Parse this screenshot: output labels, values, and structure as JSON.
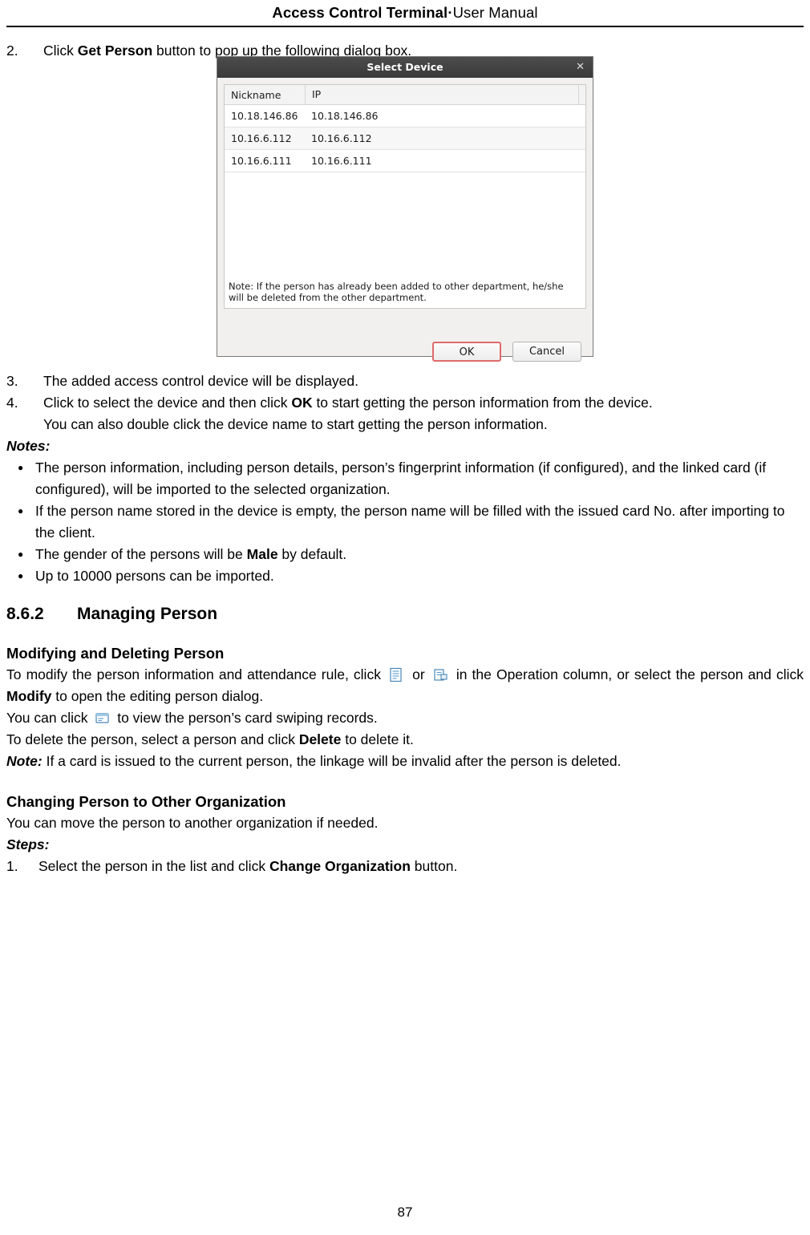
{
  "header": {
    "title_bold": "Access Control Terminal",
    "title_sep": "·",
    "title_normal": "User Manual"
  },
  "steps": {
    "step2_num": "2.",
    "step2_a": "Click ",
    "step2_bold": "Get Person",
    "step2_b": " button to pop up the following dialog box.",
    "step3_num": "3.",
    "step3_text": "The added access control device will be displayed.",
    "step4_num": "4.",
    "step4_a": "Click to select the device and then click ",
    "step4_bold": "OK",
    "step4_b": " to start getting the person information from the device.",
    "step4_c": "You can also double click the device name to start getting the person information."
  },
  "dialog": {
    "title": "Select Device",
    "close": "✕",
    "columns": [
      "Nickname",
      "IP"
    ],
    "rows": [
      {
        "nickname": "10.18.146.86",
        "ip": "10.18.146.86"
      },
      {
        "nickname": "10.16.6.112",
        "ip": "10.16.6.112"
      },
      {
        "nickname": "10.16.6.111",
        "ip": "10.16.6.111"
      }
    ],
    "note": "Note: If the person has already been added to other department, he/she will be deleted from the other department.",
    "ok_label": "OK",
    "cancel_label": "Cancel"
  },
  "notes": {
    "label": "Notes:",
    "items": [
      "The person information, including person details, person’s fingerprint information (if configured), and the linked card (if configured), will be imported to the selected organization.",
      "If the person name stored in the device is empty, the person name will be filled with the issued card No. after importing to the client.",
      "The gender of the persons will be Male by default.",
      "Up to 10000 persons can be imported."
    ],
    "item3_a": "The gender of the persons will be ",
    "item3_bold": "Male",
    "item3_b": " by default."
  },
  "section": {
    "number": "8.6.2",
    "title": "Managing Person"
  },
  "modify": {
    "heading": "Modifying and Deleting Person",
    "p1_a": "To modify the person information and attendance rule, click ",
    "p1_or": " or ",
    "p1_b": " in the Operation column, or select the person and click ",
    "p1_bold": "Modify",
    "p1_c": " to open the editing person dialog.",
    "p2_a": "You can click ",
    "p2_b": " to view the person’s card swiping records.",
    "p3_a": "To delete the person, select a person and click ",
    "p3_bold": "Delete",
    "p3_b": " to delete it.",
    "note_label": "Note:",
    "note_text": " If a card is issued to the current person, the linkage will be invalid after the person is deleted."
  },
  "changing": {
    "heading": "Changing Person to Other Organization",
    "p1": "You can move the person to another organization if needed.",
    "steps_label": "Steps:",
    "step1_num": "1.",
    "step1_a": "Select the person in the list and click ",
    "step1_bold": "Change Organization",
    "step1_b": " button."
  },
  "footer": {
    "page_number": "87"
  }
}
